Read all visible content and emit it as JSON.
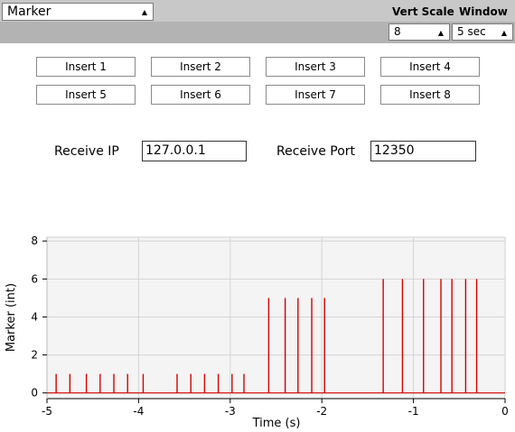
{
  "header": {
    "stream_select": {
      "value": "Marker"
    },
    "vert_scale": {
      "label": "Vert Scale",
      "value": "8"
    },
    "window": {
      "label": "Window",
      "value": "5 sec"
    }
  },
  "insert_buttons": [
    "Insert 1",
    "Insert 2",
    "Insert 3",
    "Insert 4",
    "Insert 5",
    "Insert 6",
    "Insert 7",
    "Insert 8"
  ],
  "network": {
    "receive_ip_label": "Receive IP",
    "receive_ip_value": "127.0.0.1",
    "receive_port_label": "Receive Port",
    "receive_port_value": "12350"
  },
  "colors": {
    "series": "#d40000",
    "plot_bg": "#f4f4f4",
    "grid": "#d4d4d4",
    "topbar": "#c8c8c8"
  },
  "chart_data": {
    "type": "line",
    "title": "",
    "xlabel": "Time (s)",
    "ylabel": "Marker (int)",
    "xlim": [
      -5,
      0
    ],
    "ylim": [
      -0.3,
      8.2
    ],
    "xticks": [
      -5,
      -4,
      -3,
      -2,
      -1,
      0
    ],
    "yticks": [
      0,
      2,
      4,
      6,
      8
    ],
    "grid": true,
    "series": [
      {
        "x": [
          -4.9,
          -4.75,
          -4.57,
          -4.42,
          -4.27,
          -4.12,
          -3.95,
          -3.58,
          -3.43,
          -3.28,
          -3.13,
          -2.98,
          -2.85,
          -2.58,
          -2.4,
          -2.26,
          -2.11,
          -1.97,
          -1.33,
          -1.12,
          -0.89,
          -0.7,
          -0.58,
          -0.43,
          -0.31
        ],
        "y": [
          1,
          1,
          1,
          1,
          1,
          1,
          1,
          1,
          1,
          1,
          1,
          1,
          1,
          5,
          5,
          5,
          5,
          5,
          6,
          6,
          6,
          6,
          6,
          6,
          6
        ]
      }
    ]
  }
}
